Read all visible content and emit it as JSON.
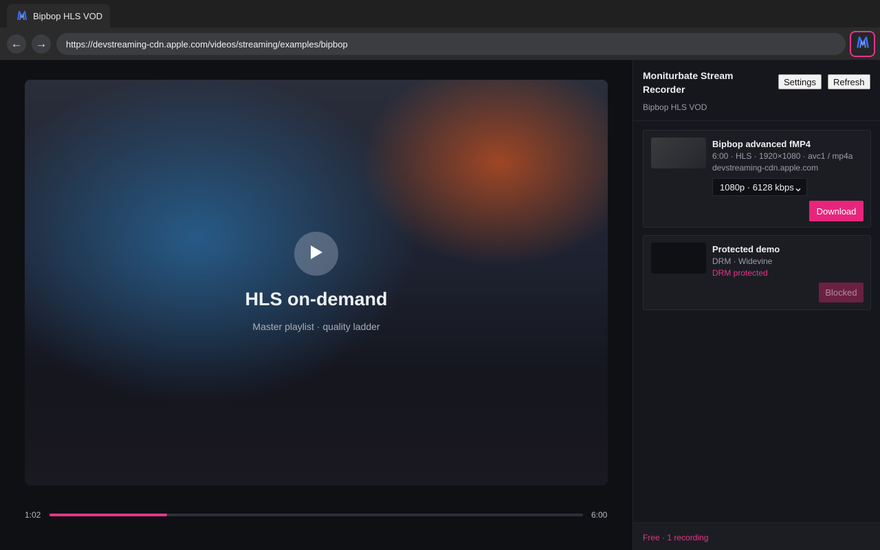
{
  "browser": {
    "tab_title": "Bipbop HLS VOD",
    "back_label": "←",
    "forward_label": "→",
    "url": "https://devstreaming-cdn.apple.com/videos/streaming/examples/bipbop",
    "extension_icon": "monitor-m-logo-icon"
  },
  "player": {
    "title": "HLS on-demand",
    "subtitle": "Master playlist · quality ladder",
    "current_time": "1:02",
    "duration": "6:00",
    "progress_fraction": 0.22,
    "play_icon": "play-icon"
  },
  "panel": {
    "title": "Moniturbate Stream Recorder",
    "page_name": "Bipbop HLS VOD",
    "settings_label": "Settings",
    "refresh_label": "Refresh",
    "streams": [
      {
        "title": "Bipbop advanced fMP4",
        "meta": "6:00 · HLS · 1920×1080 · avc1 / mp4a",
        "host": "devstreaming-cdn.apple.com",
        "quality": "1080p · 6128 kbps",
        "action_label": "Download"
      },
      {
        "title": "Protected demo",
        "meta": "DRM · Widevine",
        "status": "DRM protected",
        "action_label": "Blocked"
      }
    ],
    "footer": "Free · 1 recording"
  },
  "colors": {
    "accent": "#e8348a",
    "download_button": "#e8257c",
    "blocked_button": "#6a2141"
  }
}
